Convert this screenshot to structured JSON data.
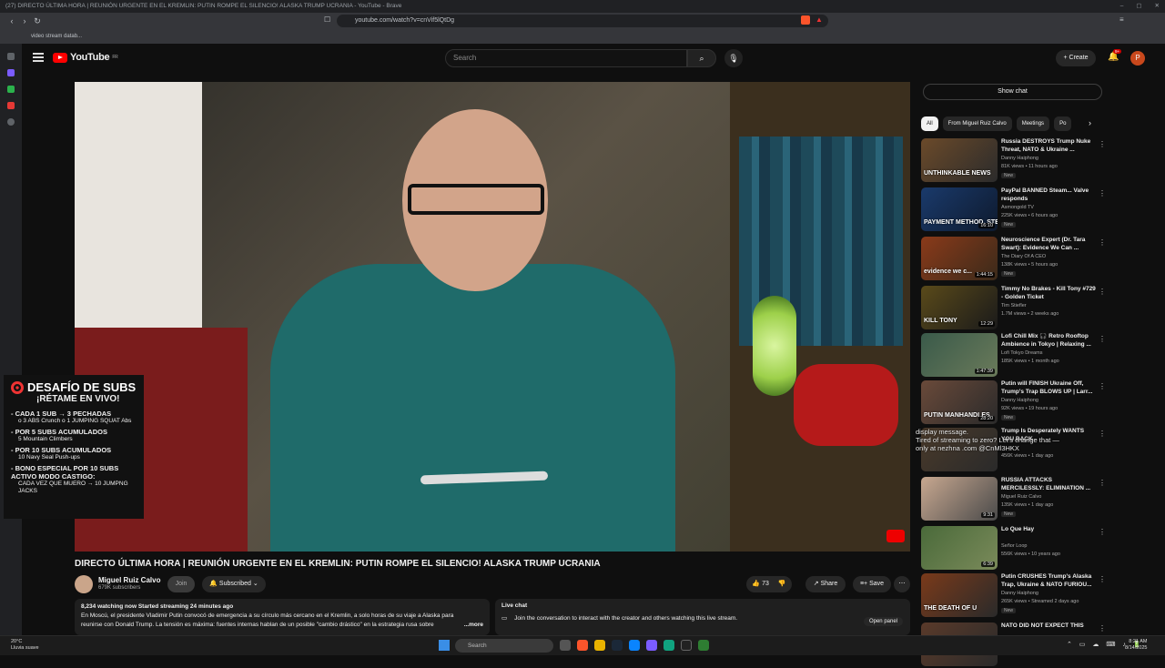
{
  "window_title": "(27) DIRECTO ÚLTIMA HORA | REUNIÓN URGENTE EN EL KREMLIN: PUTIN ROMPE EL SILENCIO! ALASKA TRUMP UCRANIA - YouTube - Brave",
  "url": "youtube.com/watch?v=cnVif5lQtDg",
  "bookmark": "video stream datab...",
  "yt": {
    "logo_text": "YouTube",
    "country": "FR",
    "search_placeholder": "Search",
    "create_label": "Create",
    "notif_count": "9+",
    "avatar_letter": "P"
  },
  "overlay": {
    "title": "DESAFÍO DE SUBS",
    "subtitle": "¡RÉTAME EN VIVO!",
    "lines": [
      {
        "main": "- CADA 1 SUB → 3 PECHADAS",
        "note": "o 3 ABS Crunch o 1 JUMPING SQUAT Abs"
      },
      {
        "main": "- POR 5 SUBS ACUMULADOS",
        "note": "5 Mountain Climbers"
      },
      {
        "main": "- POR 10 SUBS ACUMULADOS",
        "note": "10 Navy Seal Push-ups"
      },
      {
        "main": "- BONO ESPECIAL POR 10 SUBS ACTIVO MODO CASTIGO:",
        "note": "CADA VEZ QUE MUERO → 10 JUMPNG JACKS"
      }
    ]
  },
  "video_title": "DIRECTO ÚLTIMA HORA | REUNIÓN URGENTE EN EL KREMLIN: PUTIN ROMPE EL SILENCIO! ALASKA TRUMP UCRANIA",
  "channel": {
    "name": "Miguel Ruiz Calvo",
    "subs": "679K subscribers",
    "join": "Join",
    "subscribed": "Subscribed"
  },
  "actions": {
    "likes": "73",
    "share": "Share",
    "save": "Save"
  },
  "description": {
    "stats": "8,234 watching now  Started streaming 24 minutes ago",
    "text1": "En Moscú, el presidente Vladimir Putin convocó de emergencia a su círculo más cercano en el Kremlin, a solo horas de su viaje a Alaska para",
    "text2": "reunirse con Donald Trump. La tensión es máxima: fuentes internas hablan de un posible \"cambio drástico\" en la estrategia rusa sobre",
    "more": "...more"
  },
  "live_chat": {
    "title": "Live chat",
    "text": "Join the conversation to interact with the creator and others watching this live stream.",
    "open": "Open panel"
  },
  "sidebar": {
    "show_chat": "Show chat",
    "chips": [
      "All",
      "From Miguel Ruiz Calvo",
      "Meetings",
      "Po"
    ],
    "recs": [
      {
        "title": "Russia DESTROYS Trump Nuke Threat, NATO & Ukraine ...",
        "channel": "Danny Haiphong",
        "meta": "81K views • 11 hours ago",
        "badge": "New",
        "duration": "",
        "thumb": "UNTHINKABLE NEWS",
        "c1": "#6b4a2a",
        "c2": "#2b2b2b"
      },
      {
        "title": "PayPal BANNED Steam... Valve responds",
        "channel": "Asmongold TV",
        "meta": "225K views • 6 hours ago",
        "badge": "New",
        "duration": "16:10",
        "thumb": "PAYMENT METHOD, STEP 2",
        "c1": "#1a3a6b",
        "c2": "#0e1a2e"
      },
      {
        "title": "Neuroscience Expert (Dr. Tara Swart): Evidence We Can ...",
        "channel": "The Diary Of A CEO",
        "meta": "138K views • 5 hours ago",
        "badge": "New",
        "duration": "1:44:15",
        "thumb": "evidence we c...",
        "c1": "#8a3a1a",
        "c2": "#3a2a1a"
      },
      {
        "title": "Timmy No Brakes - Kill Tony #729 - Golden Ticket",
        "channel": "Tim Stiefler",
        "meta": "1.7M views • 2 weeks ago",
        "badge": "",
        "duration": "12:29",
        "thumb": "KILL TONY",
        "c1": "#5a4a1a",
        "c2": "#1a1a1a"
      },
      {
        "title": "Lofi Chill Mix 🎧 Retro Rooftop Ambience in Tokyo | Relaxing ...",
        "channel": "Lofi Tokyo Dreams",
        "meta": "185K views • 1 month ago",
        "badge": "",
        "duration": "1:47:39",
        "thumb": "",
        "c1": "#3a5a4a",
        "c2": "#6a7a5a"
      },
      {
        "title": "Putin will FINISH Ukraine Off, Trump's Trap BLOWS UP | Larr...",
        "channel": "Danny Haiphong",
        "meta": "92K views • 19 hours ago",
        "badge": "New",
        "duration": "28:20",
        "thumb": "PUTIN MANHANDLES",
        "c1": "#6a4a3a",
        "c2": "#2a2a2a"
      },
      {
        "title": "Trump Is Desperately WANTS YOU BACK",
        "channel": "",
        "meta": "456K views • 1 day ago",
        "badge": "",
        "duration": "",
        "thumb": "",
        "c1": "#4a3a2a",
        "c2": "#2a2a2a"
      },
      {
        "title": "RUSSIA ATTACKS MERCILESSLY: ELIMINATION ...",
        "channel": "Miguel Ruiz Calvo",
        "meta": "135K views • 1 day ago",
        "badge": "New",
        "duration": "9:31",
        "thumb": "",
        "c1": "#c8a890",
        "c2": "#4a4a4a"
      },
      {
        "title": "Lo Que Hay",
        "channel": "Señor Loop",
        "meta": "556K views • 10 years ago",
        "badge": "",
        "duration": "6:39",
        "thumb": "",
        "c1": "#4a6a3a",
        "c2": "#7a8a5a"
      },
      {
        "title": "Putin CRUSHES Trump's Alaska Trap, Ukraine & NATO FURIOU...",
        "channel": "Danny Haiphong",
        "meta": "265K views • Streamed 2 days ago",
        "badge": "New",
        "duration": "",
        "thumb": "THE DEATH OF U",
        "c1": "#7a3a1a",
        "c2": "#2a2a2a"
      },
      {
        "title": "NATO DID NOT EXPECT THIS",
        "channel": "",
        "meta": "",
        "badge": "",
        "duration": "",
        "thumb": "",
        "c1": "#5a3a2a",
        "c2": "#2a2a2a"
      }
    ]
  },
  "chat_overlay": {
    "line1": "display message.",
    "line2": "Tired of streaming to zero? Let's change that —",
    "line3": "only at nezhna .com @CnMl3HKX"
  },
  "taskbar": {
    "temp": "20°C",
    "weather": "Lluvia suave",
    "search": "Search",
    "time": "8:21 AM",
    "date": "8/14/2025"
  }
}
